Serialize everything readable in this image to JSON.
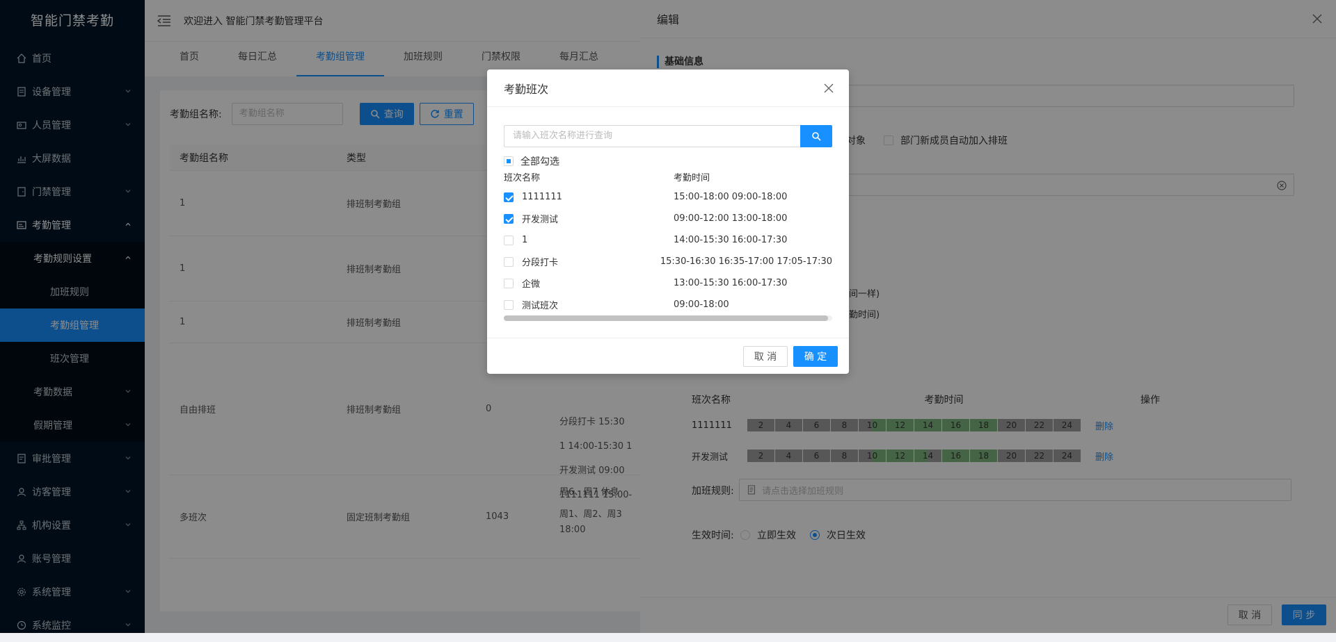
{
  "app": {
    "logo": "智能门禁考勤",
    "header_title": "欢迎进入 智能门禁考勤管理平台"
  },
  "sidebar": {
    "items": [
      {
        "label": "首页",
        "icon": "home-icon"
      },
      {
        "label": "设备管理",
        "icon": "device-icon"
      },
      {
        "label": "人员管理",
        "icon": "people-icon"
      },
      {
        "label": "大屏数据",
        "icon": "chart-icon"
      },
      {
        "label": "门禁管理",
        "icon": "door-icon"
      },
      {
        "label": "考勤管理",
        "icon": "attendance-icon"
      },
      {
        "label": "考勤规则设置"
      },
      {
        "label": "加班规则"
      },
      {
        "label": "考勤组管理"
      },
      {
        "label": "班次管理"
      },
      {
        "label": "考勤数据"
      },
      {
        "label": "假期管理"
      },
      {
        "label": "审批管理",
        "icon": "approval-icon"
      },
      {
        "label": "访客管理",
        "icon": "visitor-icon"
      },
      {
        "label": "机构设置",
        "icon": "org-icon"
      },
      {
        "label": "账号管理",
        "icon": "account-icon"
      },
      {
        "label": "系统管理",
        "icon": "gear-icon"
      },
      {
        "label": "系统监控",
        "icon": "monitor-icon"
      }
    ]
  },
  "tabs": [
    "首页",
    "每日汇总",
    "考勤组管理",
    "加班规则",
    "门禁权限",
    "每月汇总"
  ],
  "filter": {
    "label": "考勤组名称:",
    "placeholder": "考勤组名称",
    "query": "查询",
    "reset": "重置"
  },
  "table": {
    "headers": [
      "考勤组名称",
      "类型"
    ],
    "rows": [
      {
        "name": "1",
        "type": "排班制考勤组",
        "count": "",
        "shifts": ""
      },
      {
        "name": "1",
        "type": "排班制考勤组",
        "count": "",
        "shifts": ""
      },
      {
        "name": "1",
        "type": "排班制考勤组",
        "count": "",
        "shifts": ""
      },
      {
        "name": "自由排班",
        "type": "排班制考勤组",
        "count": "0",
        "shifts": [
          "分段打卡 15:30",
          "1 14:00-15:30 1",
          "开发测试 09:00",
          "1111111 15:00-"
        ]
      },
      {
        "name": "多班次",
        "type": "固定班制考勤组",
        "count": "1043",
        "shifts": [
          "周6、周7 休息",
          "周1、周2、周3",
          "18:00"
        ]
      }
    ]
  },
  "drawer": {
    "title": "编辑",
    "section": "基础信息",
    "partial_object": "对象",
    "auto_join": "部门新成员自动加入排班",
    "same_time": "间一样)",
    "work_time": "勤时间)",
    "shift_headers": [
      "班次名称",
      "考勤时间",
      "操作"
    ],
    "shift_rows": [
      {
        "name": "1111111",
        "action": "删除"
      },
      {
        "name": "开发测试",
        "action": "删除"
      }
    ],
    "bar_ticks": [
      "2",
      "4",
      "6",
      "8",
      "10",
      "12",
      "14",
      "16",
      "18",
      "20",
      "22",
      "24"
    ],
    "overtime_label": "加班规则:",
    "overtime_placeholder": "请点击选择加班规则",
    "effective_label": "生效时间:",
    "effective_options": [
      "立即生效",
      "次日生效"
    ],
    "cancel": "取 消",
    "sync": "同 步"
  },
  "modal": {
    "title": "考勤班次",
    "search_placeholder": "请输入班次名称进行查询",
    "select_all": "全部勾选",
    "col_name": "班次名称",
    "col_time": "考勤时间",
    "rows": [
      {
        "name": "1111111",
        "time": "15:00-18:00 09:00-18:00",
        "checked": true
      },
      {
        "name": "开发测试",
        "time": "09:00-12:00 13:00-18:00",
        "checked": true
      },
      {
        "name": "1",
        "time": "14:00-15:30 16:00-17:30",
        "checked": false
      },
      {
        "name": "分段打卡",
        "time": "15:30-16:30 16:35-17:00 17:05-17:30",
        "checked": false
      },
      {
        "name": "企微",
        "time": "13:00-15:30 16:00-17:30",
        "checked": false
      },
      {
        "name": "测试班次",
        "time": "09:00-18:00",
        "checked": false
      }
    ],
    "cancel": "取 消",
    "ok": "确 定"
  },
  "colors": {
    "primary": "#1890ff",
    "sidebar": "#001529",
    "bar_gray": "#9e9e9e",
    "bar_green": "#7fb77f"
  }
}
